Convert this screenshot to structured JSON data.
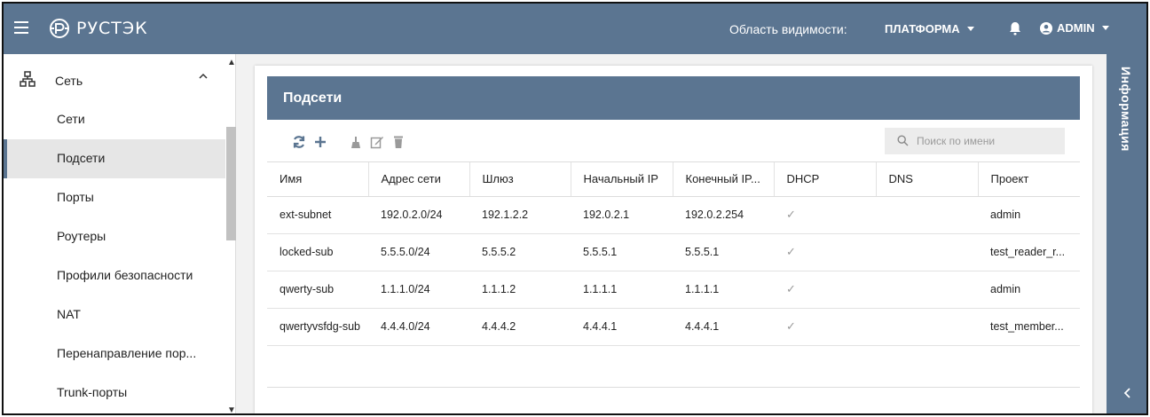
{
  "app": {
    "logo_text": "РУСТЭК"
  },
  "topbar": {
    "scope_label": "Область видимости:",
    "scope_value": "ПЛАТФОРМА",
    "user_label": "ADMIN"
  },
  "sidebar": {
    "section_label": "Сеть",
    "items": [
      {
        "label": "Сети",
        "active": false
      },
      {
        "label": "Подсети",
        "active": true
      },
      {
        "label": "Порты",
        "active": false
      },
      {
        "label": "Роутеры",
        "active": false
      },
      {
        "label": "Профили безопасности",
        "active": false
      },
      {
        "label": "NAT",
        "active": false
      },
      {
        "label": "Перенаправление пор...",
        "active": false
      },
      {
        "label": "Trunk-порты",
        "active": false
      }
    ]
  },
  "main": {
    "title": "Подсети",
    "search_placeholder": "Поиск по имени",
    "columns": [
      "Имя",
      "Адрес сети",
      "Шлюз",
      "Начальный IP",
      "Конечный IP...",
      "DHCP",
      "DNS",
      "Проект"
    ],
    "rows": [
      [
        "ext-subnet",
        "192.0.2.0/24",
        "192.1.2.2",
        "192.0.2.1",
        "192.0.2.254",
        "✓",
        "",
        "admin"
      ],
      [
        "locked-sub",
        "5.5.5.0/24",
        "5.5.5.2",
        "5.5.5.1",
        "5.5.5.1",
        "✓",
        "",
        "test_reader_r..."
      ],
      [
        "qwerty-sub",
        "1.1.1.0/24",
        "1.1.1.2",
        "1.1.1.1",
        "1.1.1.1",
        "✓",
        "",
        "admin"
      ],
      [
        "qwertyvsfdg-sub",
        "4.4.4.0/24",
        "4.4.4.2",
        "4.4.4.1",
        "4.4.4.1",
        "✓",
        "",
        "test_member..."
      ]
    ]
  },
  "info_rail": {
    "label": "Информация"
  },
  "colors": {
    "brand": "#5b7591",
    "active_item_bg": "#e6e6e6"
  },
  "icons": [
    "menu-icon",
    "logo-icon",
    "bell-icon",
    "user-circle-icon",
    "network-icon",
    "refresh-icon",
    "plus-icon",
    "broom-icon",
    "edit-icon",
    "trash-icon",
    "search-icon",
    "chevron-left-icon"
  ]
}
